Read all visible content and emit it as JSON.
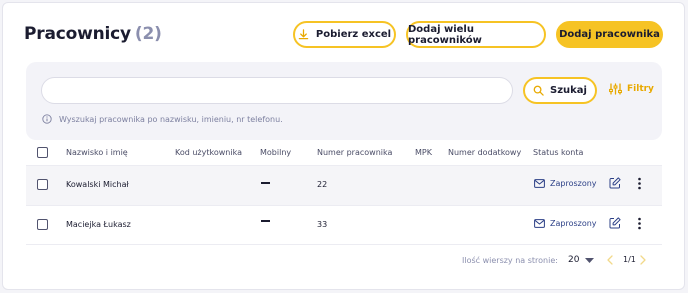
{
  "header": {
    "title": "Pracownicy",
    "count": "(2)",
    "buttons": {
      "excel": "Pobierz excel",
      "bulk_add": "Dodaj wielu pracowników",
      "add": "Dodaj pracownika"
    }
  },
  "search": {
    "placeholder": "",
    "button": "Szukaj",
    "filters": "Filtry",
    "hint": "Wyszukaj pracownika po nazwisku, imieniu, nr telefonu."
  },
  "table": {
    "columns": [
      "Nazwisko i imię",
      "Kod użytkownika",
      "Mobilny",
      "Numer pracownika",
      "MPK",
      "Numer dodatkowy",
      "Status konta"
    ],
    "rows": [
      {
        "name": "Kowalski Michał",
        "user_code": "",
        "mobile": "—",
        "employee_number": "22",
        "mpk": "",
        "extra_number": "",
        "status": "Zaproszony"
      },
      {
        "name": "Maciejka Łukasz",
        "user_code": "",
        "mobile": "—",
        "employee_number": "33",
        "mpk": "",
        "extra_number": "",
        "status": "Zaproszony"
      }
    ]
  },
  "pagination": {
    "rows_per_page_label": "Ilość wierszy na stronie:",
    "rows_per_page": "20",
    "page": "1/1"
  },
  "colors": {
    "accent": "#f6c324",
    "accent_icon": "#e8a900",
    "text": "#1b1c30",
    "muted": "#8b8fae",
    "status": "#2b3f86"
  },
  "icons": [
    "download-icon",
    "search-icon",
    "filter-sliders-icon",
    "info-icon",
    "mail-icon",
    "edit-icon",
    "more-vertical-icon",
    "caret-down-icon",
    "chevron-left-icon",
    "chevron-right-icon"
  ]
}
